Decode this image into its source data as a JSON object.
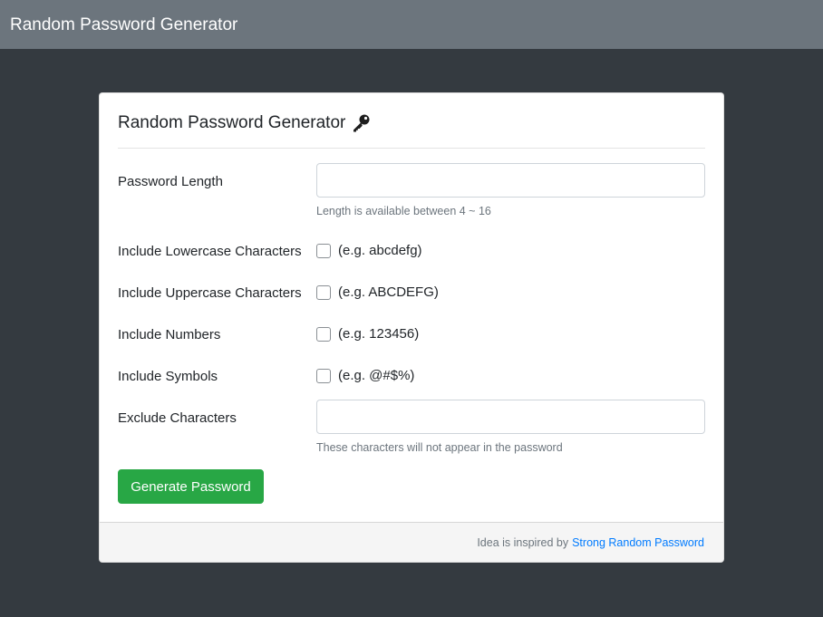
{
  "navbar": {
    "brand": "Random Password Generator"
  },
  "card": {
    "title": "Random Password Generator",
    "title_icon": "key-icon"
  },
  "form": {
    "length": {
      "label": "Password Length",
      "value": "",
      "help": "Length is available between 4 ~ 16"
    },
    "lowercase": {
      "label": "Include Lowercase Characters",
      "example": "(e.g. abcdefg)",
      "checked": false
    },
    "uppercase": {
      "label": "Include Uppercase Characters",
      "example": "(e.g. ABCDEFG)",
      "checked": false
    },
    "numbers": {
      "label": "Include Numbers",
      "example": "(e.g. 123456)",
      "checked": false
    },
    "symbols": {
      "label": "Include Symbols",
      "example": "(e.g. @#$%)",
      "checked": false
    },
    "exclude": {
      "label": "Exclude Characters",
      "value": "",
      "help": "These characters will not appear in the password"
    },
    "generate_label": "Generate Password"
  },
  "footer": {
    "text": "Idea is inspired by",
    "link_text": "Strong Random Password"
  },
  "colors": {
    "navbar_bg": "#6c757d",
    "page_bg": "#343a40",
    "button_bg": "#28a745",
    "link": "#007bff"
  }
}
